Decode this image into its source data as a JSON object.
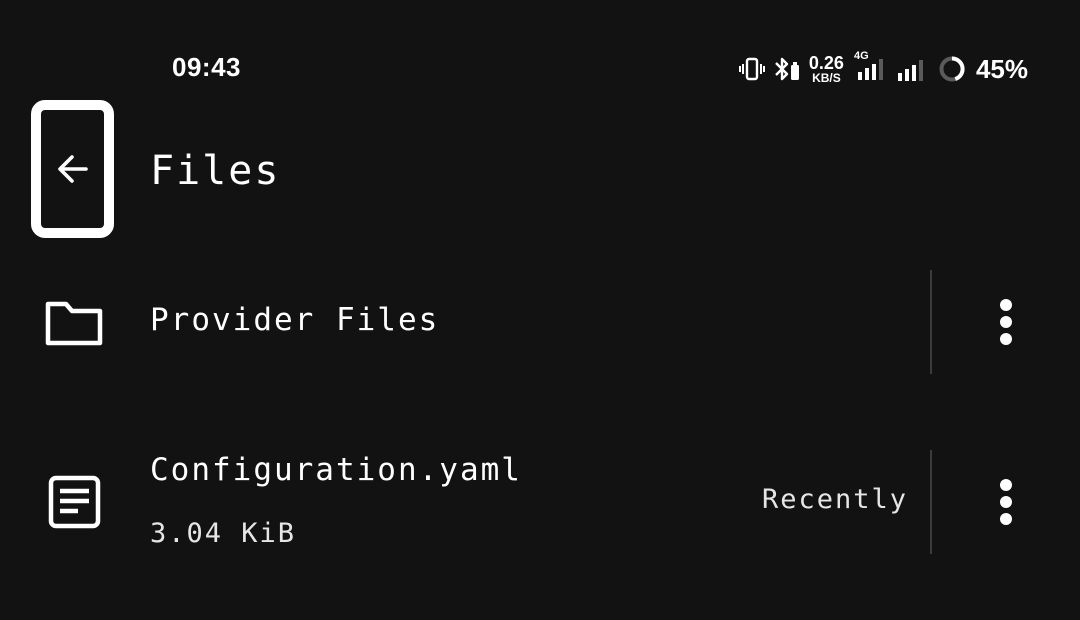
{
  "status_bar": {
    "time": "09:43",
    "net_speed_value": "0.26",
    "net_speed_unit": "KB/S",
    "network_type": "4G",
    "battery_percent": "45%",
    "icons": [
      "vibrate-icon",
      "bluetooth-battery-icon",
      "signal-4g-icon",
      "signal-icon",
      "battery-ring-icon"
    ]
  },
  "header": {
    "title": "Files",
    "back_icon": "arrow-left-icon"
  },
  "files": [
    {
      "name": "Provider Files",
      "type": "folder",
      "icon": "folder-icon",
      "size": "",
      "modified": ""
    },
    {
      "name": "Configuration.yaml",
      "type": "file",
      "icon": "document-icon",
      "size": "3.04 KiB",
      "modified": "Recently"
    }
  ],
  "colors": {
    "background": "#121212",
    "foreground": "#ffffff",
    "divider": "#3c3c3c"
  }
}
